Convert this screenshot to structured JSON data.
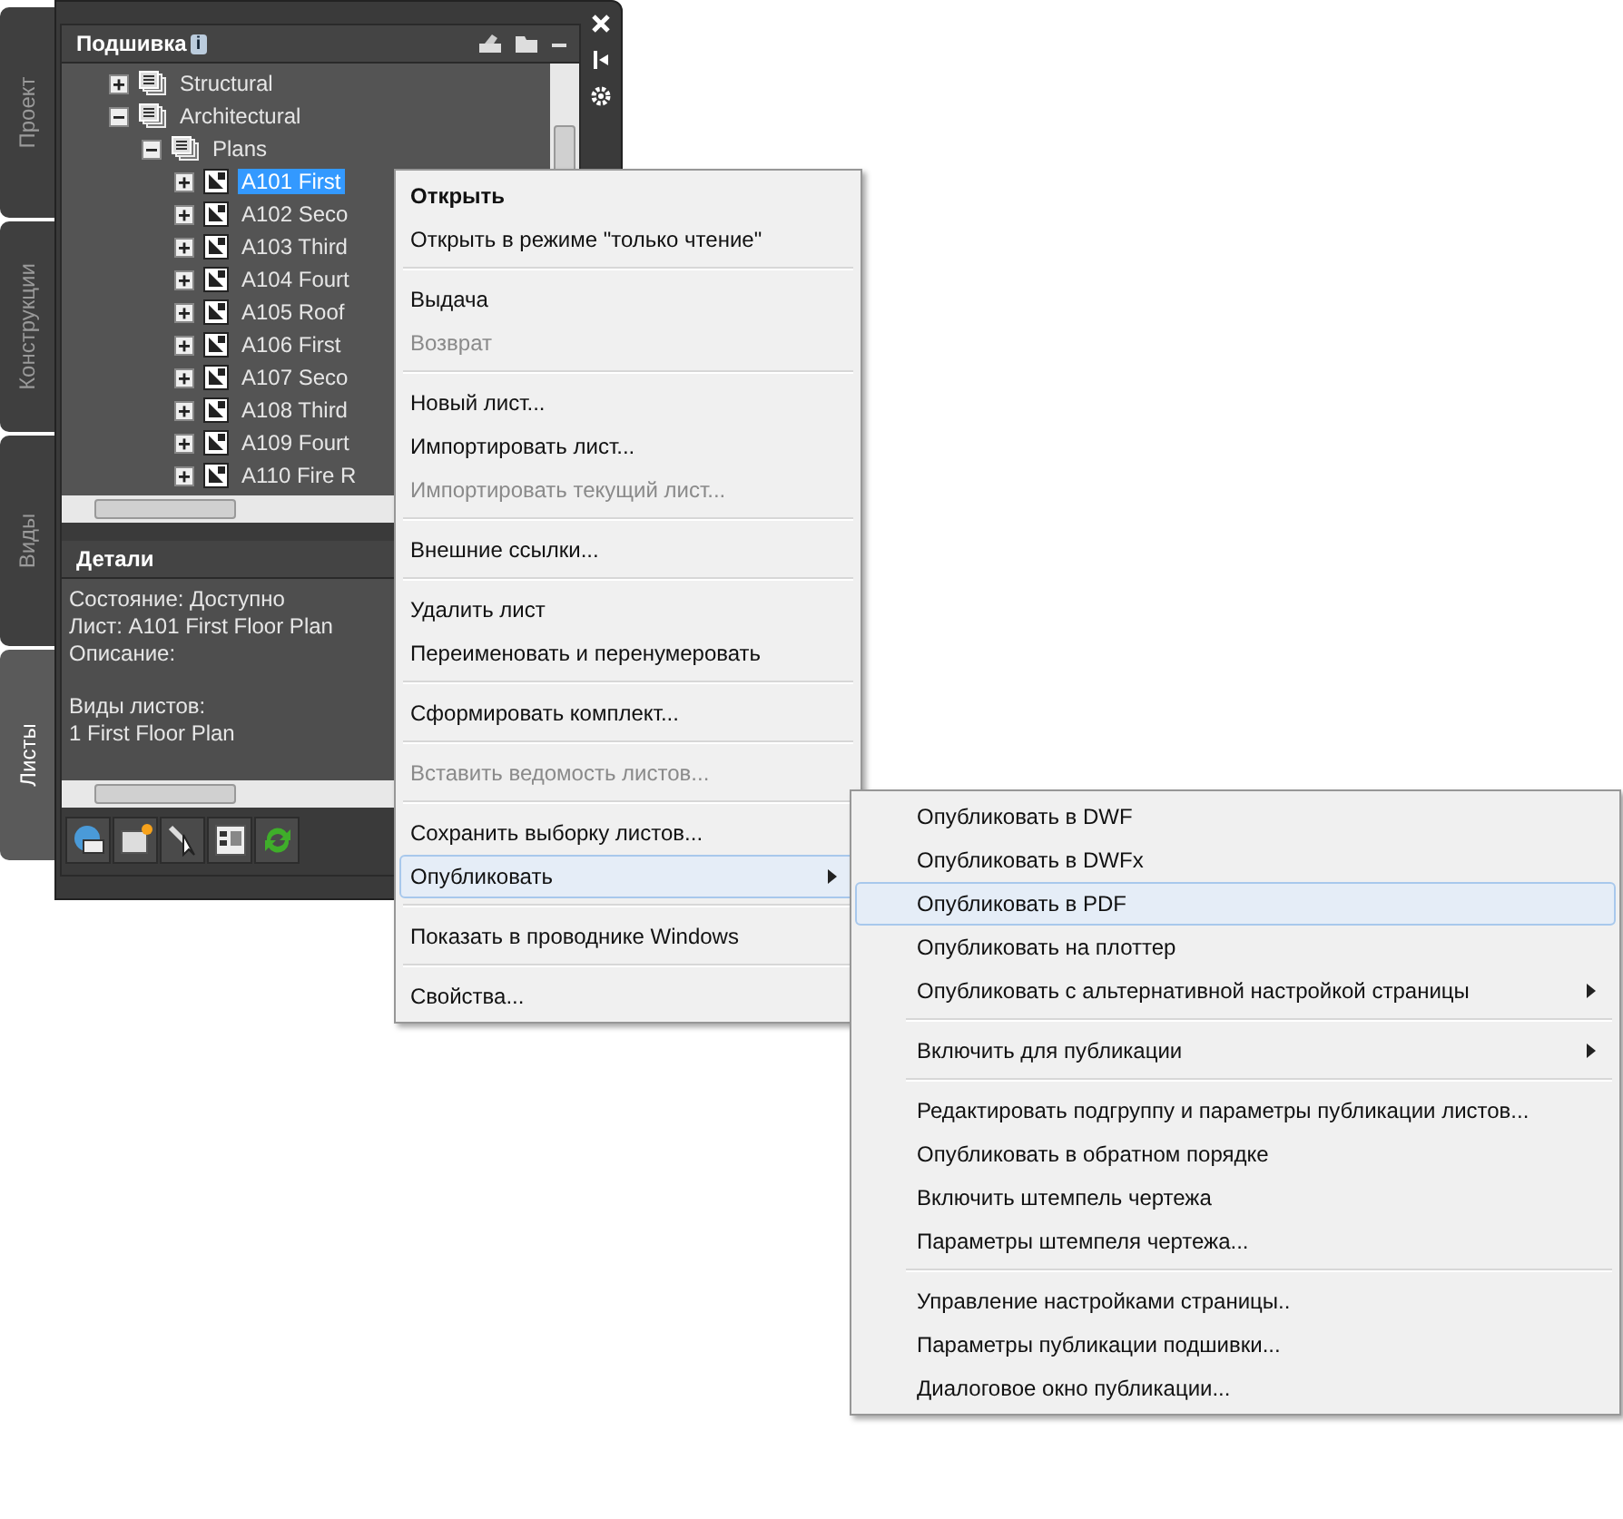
{
  "side_tabs": [
    {
      "label": "Проект",
      "selected": false
    },
    {
      "label": "Конструкции",
      "selected": false
    },
    {
      "label": "Виды",
      "selected": false
    },
    {
      "label": "Листы",
      "selected": true
    }
  ],
  "sheet_set": {
    "title": "Подшивка",
    "info": "i"
  },
  "tree": [
    {
      "label": "Structural",
      "kind": "set",
      "expanded": false,
      "selected": false
    },
    {
      "label": "Architectural",
      "kind": "set",
      "expanded": true,
      "selected": false,
      "children": [
        {
          "label": "Plans",
          "kind": "set",
          "expanded": true,
          "selected": false,
          "children": [
            {
              "label": "A101 First",
              "kind": "sheet",
              "expanded": false,
              "selected": true
            },
            {
              "label": "A102 Seco",
              "kind": "sheet",
              "expanded": false,
              "selected": false
            },
            {
              "label": "A103 Third",
              "kind": "sheet",
              "expanded": false,
              "selected": false
            },
            {
              "label": "A104 Fourt",
              "kind": "sheet",
              "expanded": false,
              "selected": false
            },
            {
              "label": "A105 Roof",
              "kind": "sheet",
              "expanded": false,
              "selected": false
            },
            {
              "label": "A106 First",
              "kind": "sheet",
              "expanded": false,
              "selected": false
            },
            {
              "label": "A107 Seco",
              "kind": "sheet",
              "expanded": false,
              "selected": false
            },
            {
              "label": "A108 Third",
              "kind": "sheet",
              "expanded": false,
              "selected": false
            },
            {
              "label": "A109 Fourt",
              "kind": "sheet",
              "expanded": false,
              "selected": false
            },
            {
              "label": "A110 Fire R",
              "kind": "sheet",
              "expanded": false,
              "selected": false
            }
          ]
        }
      ]
    }
  ],
  "details": {
    "title": "Детали",
    "groups": [
      [
        "Состояние: Доступно",
        "Лист: A101 First Floor Plan",
        "Описание:"
      ],
      [
        "Виды листов:",
        "1 First Floor Plan"
      ]
    ]
  },
  "context_menu": [
    [
      {
        "label": "Открыть",
        "bold": true,
        "disabled": false,
        "submenu": false,
        "selected": false
      },
      {
        "label": "Открыть в режиме \"только чтение\"",
        "bold": false,
        "disabled": false,
        "submenu": false,
        "selected": false
      }
    ],
    [
      {
        "label": "Выдача",
        "bold": false,
        "disabled": false,
        "submenu": false,
        "selected": false
      },
      {
        "label": "Возврат",
        "bold": false,
        "disabled": true,
        "submenu": false,
        "selected": false
      }
    ],
    [
      {
        "label": "Новый лист...",
        "bold": false,
        "disabled": false,
        "submenu": false,
        "selected": false
      },
      {
        "label": "Импортировать лист...",
        "bold": false,
        "disabled": false,
        "submenu": false,
        "selected": false
      },
      {
        "label": "Импортировать текущий лист...",
        "bold": false,
        "disabled": true,
        "submenu": false,
        "selected": false
      }
    ],
    [
      {
        "label": "Внешние ссылки...",
        "bold": false,
        "disabled": false,
        "submenu": false,
        "selected": false
      }
    ],
    [
      {
        "label": "Удалить лист",
        "bold": false,
        "disabled": false,
        "submenu": false,
        "selected": false
      },
      {
        "label": "Переименовать и перенумеровать",
        "bold": false,
        "disabled": false,
        "submenu": false,
        "selected": false
      }
    ],
    [
      {
        "label": "Сформировать комплект...",
        "bold": false,
        "disabled": false,
        "submenu": false,
        "selected": false
      }
    ],
    [
      {
        "label": "Вставить ведомость листов...",
        "bold": false,
        "disabled": true,
        "submenu": false,
        "selected": false
      }
    ],
    [
      {
        "label": "Сохранить выборку листов...",
        "bold": false,
        "disabled": false,
        "submenu": false,
        "selected": false
      },
      {
        "label": "Опубликовать",
        "bold": false,
        "disabled": false,
        "submenu": true,
        "selected": true
      }
    ],
    [
      {
        "label": "Показать в проводнике Windows",
        "bold": false,
        "disabled": false,
        "submenu": false,
        "selected": false
      }
    ],
    [
      {
        "label": "Свойства...",
        "bold": false,
        "disabled": false,
        "submenu": false,
        "selected": false
      }
    ]
  ],
  "submenu": [
    [
      {
        "label": "Опубликовать в DWF",
        "bold": false,
        "disabled": false,
        "submenu": false,
        "selected": false
      },
      {
        "label": "Опубликовать в DWFx",
        "bold": false,
        "disabled": false,
        "submenu": false,
        "selected": false
      },
      {
        "label": "Опубликовать в PDF",
        "bold": false,
        "disabled": false,
        "submenu": false,
        "selected": true
      },
      {
        "label": "Опубликовать на плоттер",
        "bold": false,
        "disabled": false,
        "submenu": false,
        "selected": false
      },
      {
        "label": "Опубликовать с альтернативной настройкой страницы",
        "bold": false,
        "disabled": false,
        "submenu": true,
        "selected": false
      }
    ],
    [
      {
        "label": "Включить для публикации",
        "bold": false,
        "disabled": false,
        "submenu": true,
        "selected": false
      }
    ],
    [
      {
        "label": "Редактировать подгруппу и параметры публикации листов...",
        "bold": false,
        "disabled": false,
        "submenu": false,
        "selected": false
      },
      {
        "label": "Опубликовать в обратном порядке",
        "bold": false,
        "disabled": false,
        "submenu": false,
        "selected": false
      },
      {
        "label": "Включить штемпель чертежа",
        "bold": false,
        "disabled": false,
        "submenu": false,
        "selected": false
      },
      {
        "label": "Параметры штемпеля чертежа...",
        "bold": false,
        "disabled": false,
        "submenu": false,
        "selected": false
      }
    ],
    [
      {
        "label": "Управление настройками страницы..",
        "bold": false,
        "disabled": false,
        "submenu": false,
        "selected": false
      },
      {
        "label": "Параметры публикации подшивки...",
        "bold": false,
        "disabled": false,
        "submenu": false,
        "selected": false
      },
      {
        "label": "Диалоговое окно публикации...",
        "bold": false,
        "disabled": false,
        "submenu": false,
        "selected": false
      }
    ]
  ]
}
